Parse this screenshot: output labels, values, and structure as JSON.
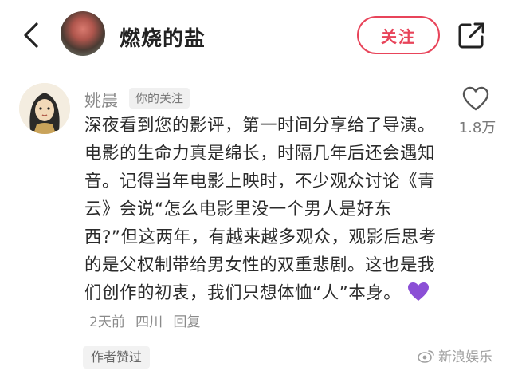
{
  "header": {
    "title": "燃烧的盐",
    "follow_label": "关注"
  },
  "comment": {
    "username": "姚晨",
    "relation_tag": "你的关注",
    "text": "深夜看到您的影评，第一时间分享给了导演。电影的生命力真是绵长，时隔几年后还会遇知音。记得当年电影上映时，不少观众讨论《青云》会说“怎么电影里没一个男人是好东西?”但这两年，有越来越多观众，观影后思考的是父权制带给男女性的双重悲剧。这也是我们创作的初衷，我们只想体恤“人”本身。",
    "time": "2天前",
    "location": "四川",
    "reply_label": "回复",
    "like_count": "1.8万",
    "author_liked_badge": "作者赞过"
  },
  "watermark": {
    "text": "新浪娱乐"
  },
  "colors": {
    "accent": "#e8445a",
    "heart": "#8b4fd6"
  }
}
